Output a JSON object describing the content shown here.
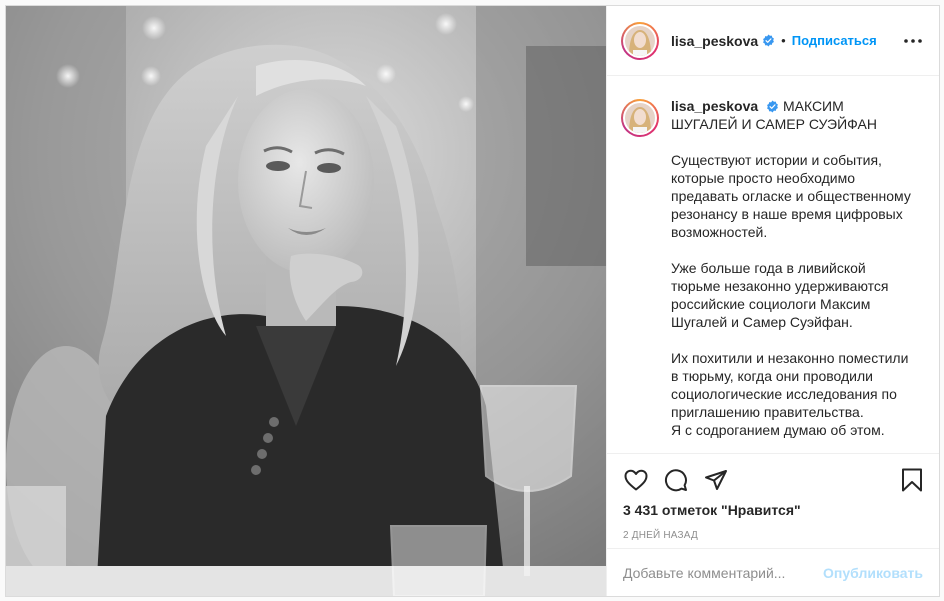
{
  "post": {
    "username": "lisa_peskova",
    "follow_label": "Подписаться",
    "separator": "•",
    "photo_icon": "black-and-white-portrait",
    "caption": {
      "headline": "МАКСИМ ШУГАЛЕЙ И САМЕР СУЭЙФАН",
      "paragraphs": [
        "Существуют истории и события, которые просто необходимо предавать огласке и общественному резонансу в наше время цифровых возможностей.",
        "Уже больше года в ливийской тюрьме незаконно удерживаются российские социологи Максим Шугалей и Самер Суэйфан.",
        "Их похитили и незаконно поместили в тюрьму, когда они проводили социологические исследования по приглашению правительства."
      ],
      "last_line": "Я с содроганием думаю об этом."
    },
    "likes_text": "3 431 отметок \"Нравится\"",
    "timestamp": "2 дней назад",
    "comment_placeholder": "Добавьте комментарий...",
    "publish_label": "Опубликовать"
  },
  "colors": {
    "accent": "#0095f6",
    "publish_disabled": "#b2dffc",
    "border": "#dbdbdb",
    "muted": "#8e8e8e"
  },
  "icons": [
    "verified-badge-icon",
    "more-options-icon",
    "heart-icon",
    "comment-icon",
    "share-icon",
    "bookmark-icon"
  ]
}
